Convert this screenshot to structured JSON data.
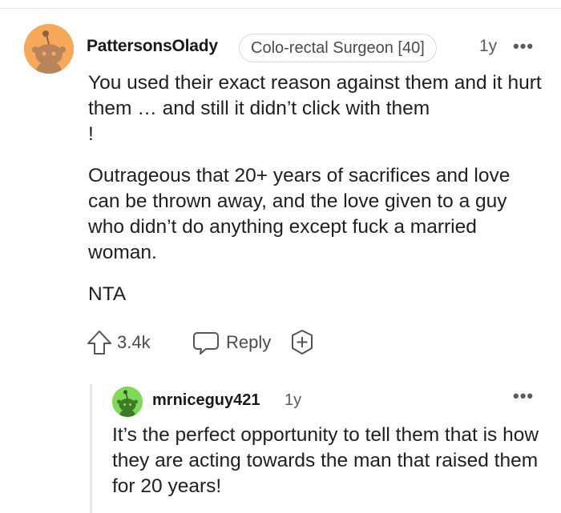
{
  "comment": {
    "author": "PattersonsOlady",
    "flair": "Colo-rectal Surgeon [40]",
    "time": "1y",
    "more_label": "•••",
    "paragraphs": [
      "You used their exact reason against them and it hurt them … and still it didn’t click with them\n!",
      "Outrageous that 20+ years of sacrifices and love can be thrown away, and the love given to a guy who didn’t do anything except fuck a married woman.",
      "NTA"
    ],
    "upvotes": "3.4k",
    "reply_label": "Reply",
    "icons": {
      "upvote": "upvote-arrow-icon",
      "reply": "speech-bubble-icon",
      "award": "award-plus-icon",
      "avatar": "snoo-avatar-icon"
    },
    "colors": {
      "avatar_bg": "#f6a85b"
    }
  },
  "reply": {
    "author": "mrniceguy421",
    "time": "1y",
    "more_label": "•••",
    "text": "It’s the perfect opportunity to tell them that is how they are acting towards the man that raised them for 20 years!",
    "colors": {
      "avatar_bg": "#7ed957"
    }
  }
}
